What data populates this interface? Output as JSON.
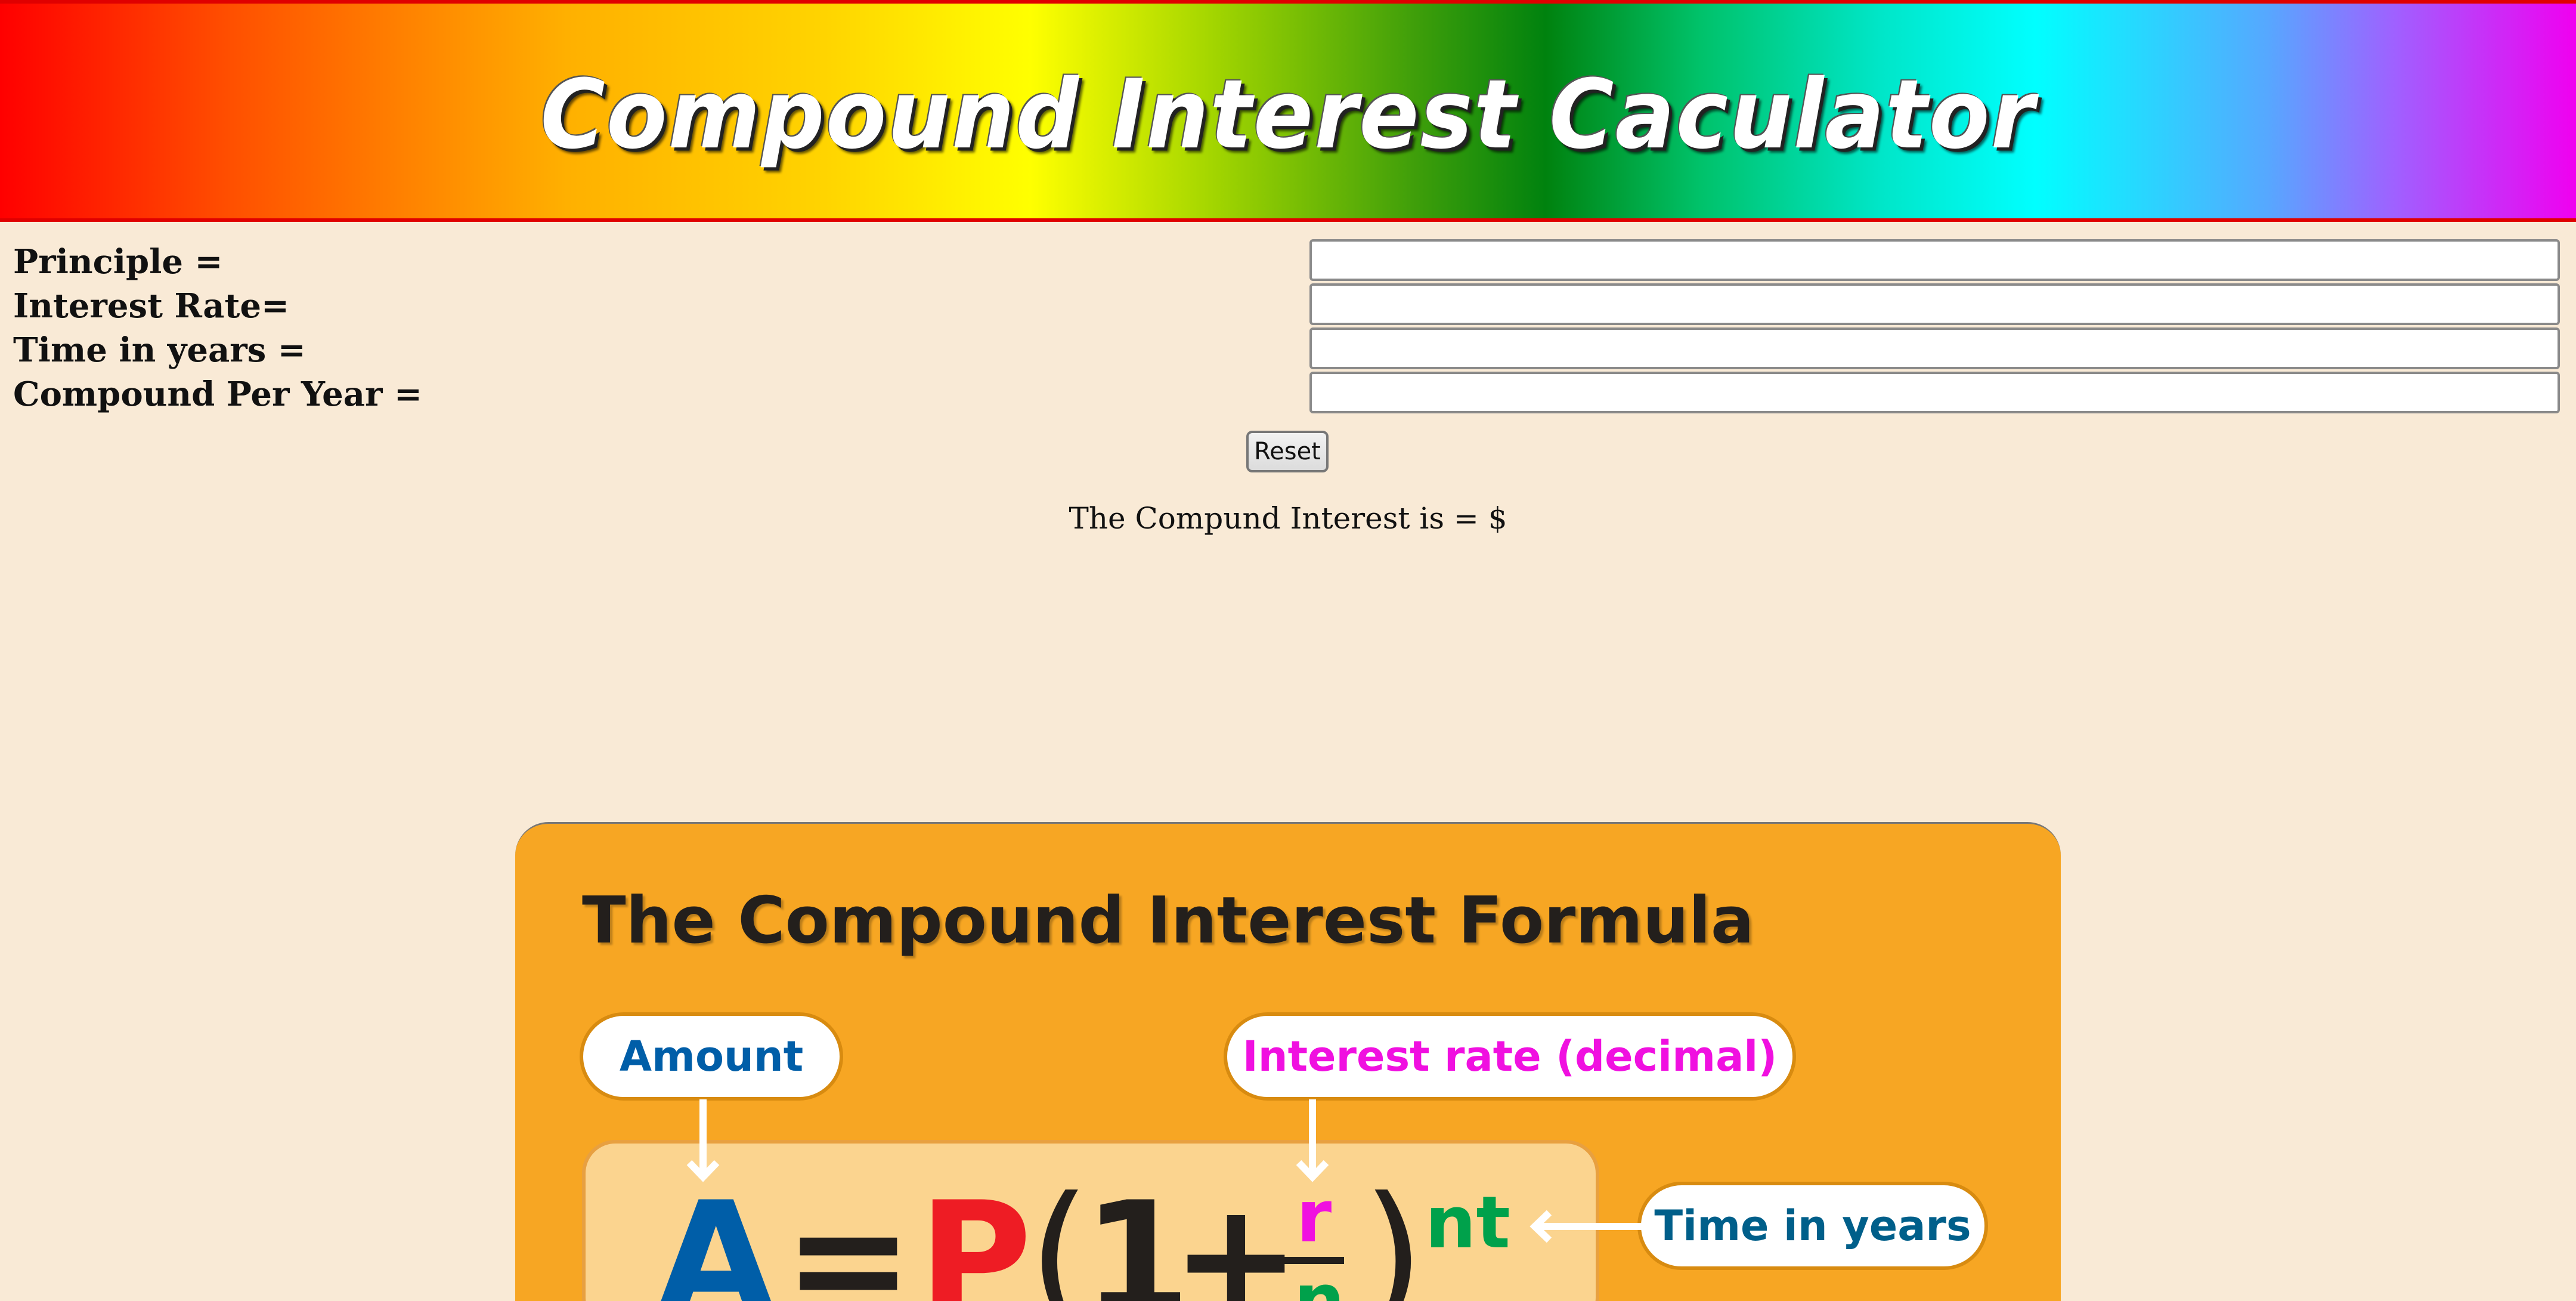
{
  "header": {
    "title": "Compound Interest Caculator"
  },
  "form": {
    "fields": [
      {
        "label": "Principle =",
        "value": ""
      },
      {
        "label": "Interest Rate=",
        "value": ""
      },
      {
        "label": "Time in years =",
        "value": ""
      },
      {
        "label": "Compound Per Year =",
        "value": ""
      }
    ],
    "reset_label": "Reset"
  },
  "result": {
    "text": "The Compund Interest is = $"
  },
  "formula_image": {
    "title": "The Compound Interest Formula",
    "callouts": {
      "amount": "Amount",
      "rate": "Interest rate (decimal)",
      "time": "Time in years"
    },
    "equation": {
      "A": "A",
      "equals": "=",
      "P": "P",
      "open": "(",
      "one": "1",
      "plus": "+",
      "r": "r",
      "n": "n",
      "close": ")",
      "exponent": "nt"
    },
    "colors": {
      "background": "#f7a623",
      "amount": "#005ea8",
      "rate": "#f010e0",
      "time": "#005f8a",
      "principal": "#ee1c24",
      "exponent": "#00a14b"
    }
  }
}
